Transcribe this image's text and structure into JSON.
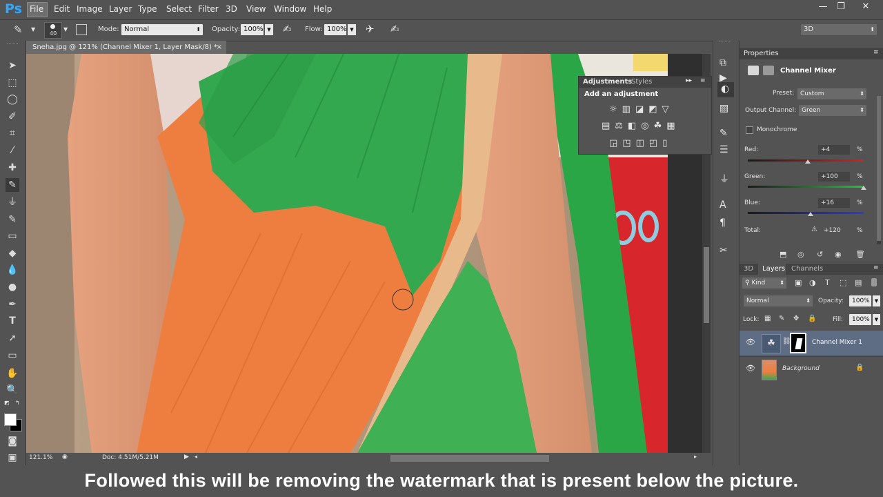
{
  "app": {
    "logo": "Ps"
  },
  "menu": [
    "File",
    "Edit",
    "Image",
    "Layer",
    "Type",
    "Select",
    "Filter",
    "3D",
    "View",
    "Window",
    "Help"
  ],
  "window_controls": [
    "—",
    "❐",
    "✕"
  ],
  "options": {
    "brush_size": "40",
    "mode_label": "Mode:",
    "mode_value": "Normal",
    "opacity_label": "Opacity:",
    "opacity_value": "100%",
    "flow_label": "Flow:",
    "flow_value": "100%",
    "workspace": "3D"
  },
  "document": {
    "tab_title": "Sneha.jpg @ 121% (Channel Mixer 1, Layer Mask/8) *",
    "close": "×"
  },
  "status": {
    "zoom": "121.1%",
    "doc_size": "Doc: 4.51M/5.21M"
  },
  "adjustments_panel": {
    "tabs": [
      "Adjustments",
      "Styles"
    ],
    "heading": "Add an adjustment"
  },
  "properties": {
    "tab": "Properties",
    "title": "Channel Mixer",
    "preset_label": "Preset:",
    "preset_value": "Custom",
    "output_label": "Output Channel:",
    "output_value": "Green",
    "monochrome_label": "Monochrome",
    "red_label": "Red:",
    "red_value": "+4",
    "green_label": "Green:",
    "green_value": "+100",
    "blue_label": "Blue:",
    "blue_value": "+16",
    "total_label": "Total:",
    "total_value": "+120",
    "percent": "%",
    "red_level": 0.52,
    "green_level": 1.0,
    "blue_level": 0.54
  },
  "layers_panel": {
    "tabs": [
      "3D",
      "Layers",
      "Channels"
    ],
    "kind_label": "Kind",
    "blend_mode": "Normal",
    "opacity_label": "Opacity:",
    "opacity_value": "100%",
    "lock_label": "Lock:",
    "fill_label": "Fill:",
    "fill_value": "100%",
    "layers": [
      {
        "name": "Channel Mixer 1"
      },
      {
        "name": "Background"
      }
    ]
  },
  "caption": "Followed this will be removing the watermark that is present below the picture."
}
